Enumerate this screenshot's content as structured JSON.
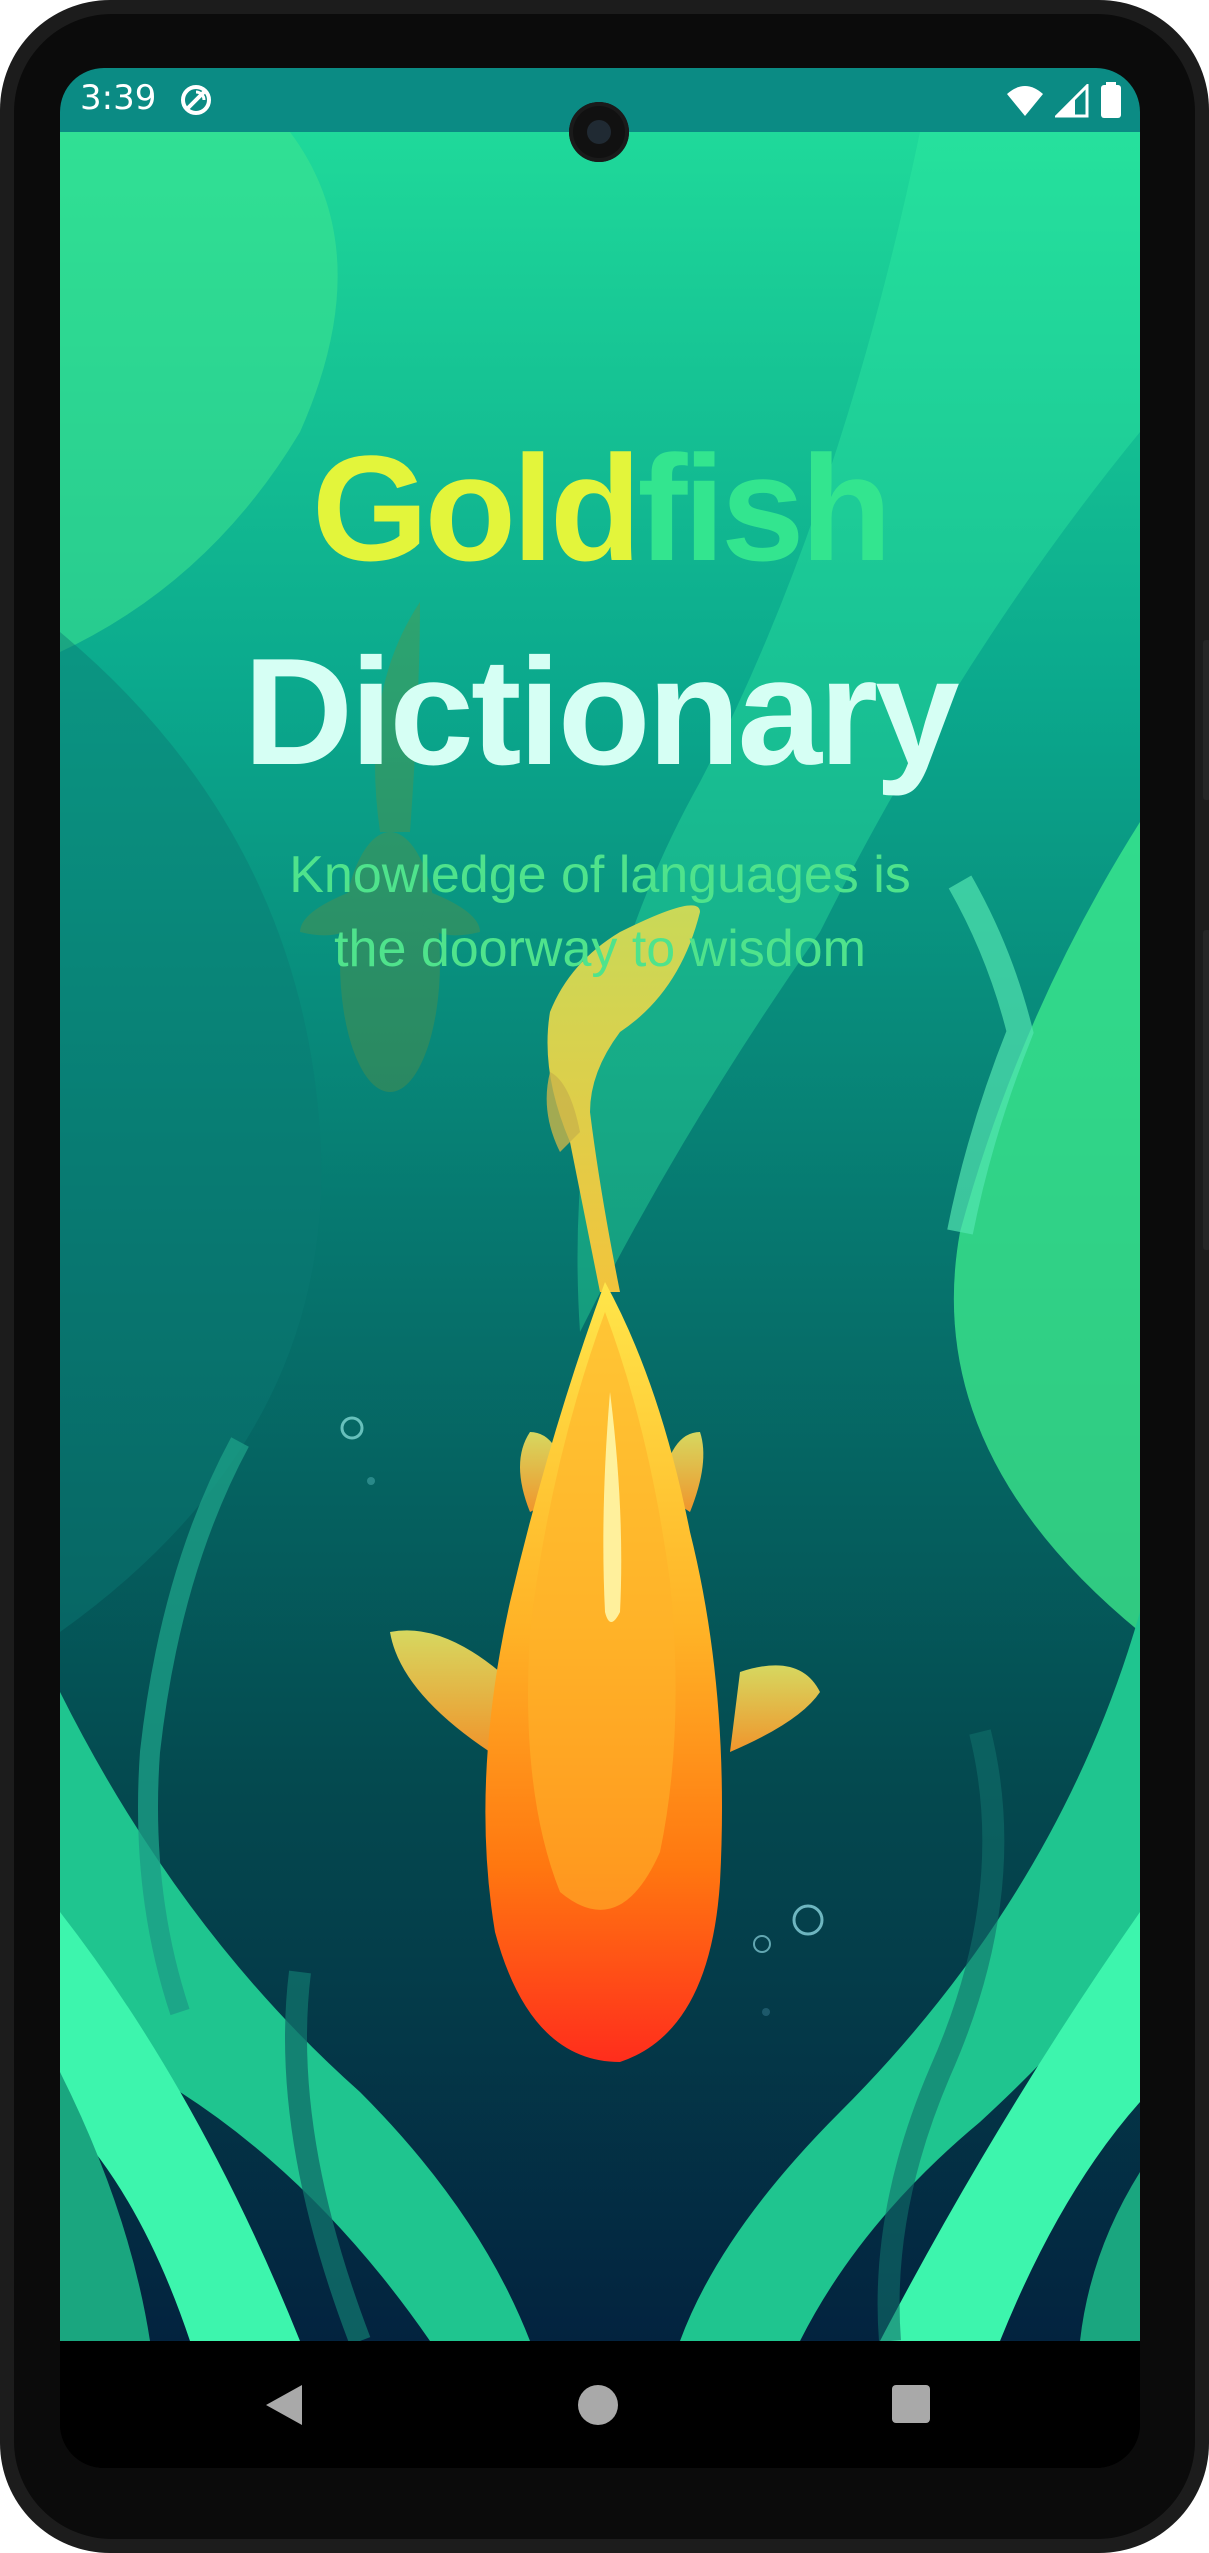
{
  "status_bar": {
    "time": "3:39"
  },
  "app": {
    "title_part1": "Gold",
    "title_part2": "fish",
    "title_line2": "Dictionary",
    "tagline_line1": "Knowledge of languages is",
    "tagline_line2": "the doorway to wisdom"
  },
  "colors": {
    "title_gold": "#e3f53b",
    "title_fish": "#33e58f",
    "title_dictionary": "#d6fff4",
    "tagline": "#4fe38c",
    "status_bar": "#0b8b84"
  },
  "icons": {
    "status": [
      "sync-icon",
      "wifi-icon",
      "cell-signal-icon",
      "battery-icon"
    ],
    "navigation": [
      "back-icon",
      "home-icon",
      "recents-icon"
    ]
  }
}
